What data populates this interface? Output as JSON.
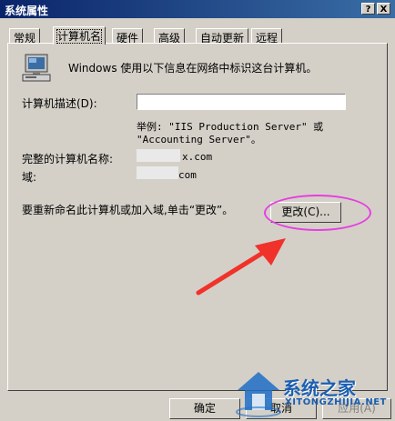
{
  "window": {
    "title": "系统属性",
    "help_label": "?",
    "close_label": "X"
  },
  "tabs": [
    {
      "label": "常规"
    },
    {
      "label": "计算机名"
    },
    {
      "label": "硬件"
    },
    {
      "label": "高级"
    },
    {
      "label": "自动更新"
    },
    {
      "label": "远程"
    }
  ],
  "content": {
    "intro": "Windows 使用以下信息在网络中标识这台计算机。",
    "desc_label": "计算机描述(D):",
    "desc_value": "",
    "example_line1": "举例: \"IIS Production Server\" 或",
    "example_line2": "\"Accounting Server\"。",
    "full_name_label": "完整的计算机名称:",
    "full_name_value": "x.com",
    "domain_label": "域:",
    "domain_value": "com",
    "rename_text": "要重新命名此计算机或加入域,单击“更改”。",
    "change_button": "更改(C)..."
  },
  "buttons": {
    "ok": "确定",
    "cancel": "取消",
    "apply": "应用(A)"
  },
  "watermark": {
    "name": "系统之家",
    "url": "XITONGZHIJIA.NET"
  },
  "colors": {
    "annotation": "#e63fe0",
    "arrow": "#f0322b",
    "titlebar": "#0a246a"
  },
  "icons": {
    "computer": "computer-icon"
  }
}
